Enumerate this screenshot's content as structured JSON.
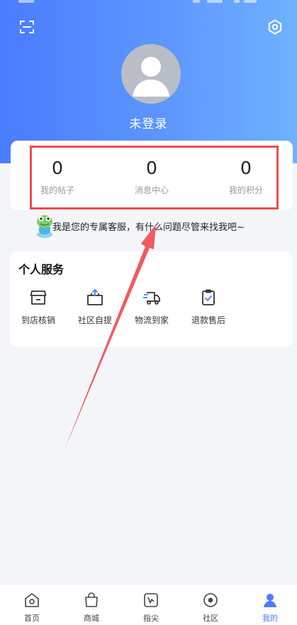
{
  "header": {
    "login_text": "未登录",
    "scan_icon": "scan-icon",
    "settings_icon": "gear-icon"
  },
  "stats": [
    {
      "value": "0",
      "label": "我的帖子"
    },
    {
      "value": "0",
      "label": "消息中心"
    },
    {
      "value": "0",
      "label": "我的积分"
    }
  ],
  "customer_service": {
    "text": "我是您的专属客服，有什么问题尽管来找我吧~"
  },
  "services": {
    "title": "个人服务",
    "items": [
      {
        "label": "到店核销",
        "icon": "store-icon"
      },
      {
        "label": "社区自提",
        "icon": "pickup-box-icon"
      },
      {
        "label": "物流到家",
        "icon": "delivery-truck-icon"
      },
      {
        "label": "退款售后",
        "icon": "refund-clipboard-icon"
      }
    ]
  },
  "tabbar": {
    "items": [
      {
        "label": "首页",
        "icon": "home-icon",
        "active": false
      },
      {
        "label": "商城",
        "icon": "shopping-bag-icon",
        "active": false
      },
      {
        "label": "指尖",
        "icon": "fingertip-icon",
        "active": false
      },
      {
        "label": "社区",
        "icon": "community-icon",
        "active": false
      },
      {
        "label": "我的",
        "icon": "profile-icon",
        "active": true
      }
    ]
  },
  "colors": {
    "brand": "#4a7cff",
    "highlight_box": "#ee4b4f",
    "arrow": "#f25a5e"
  }
}
